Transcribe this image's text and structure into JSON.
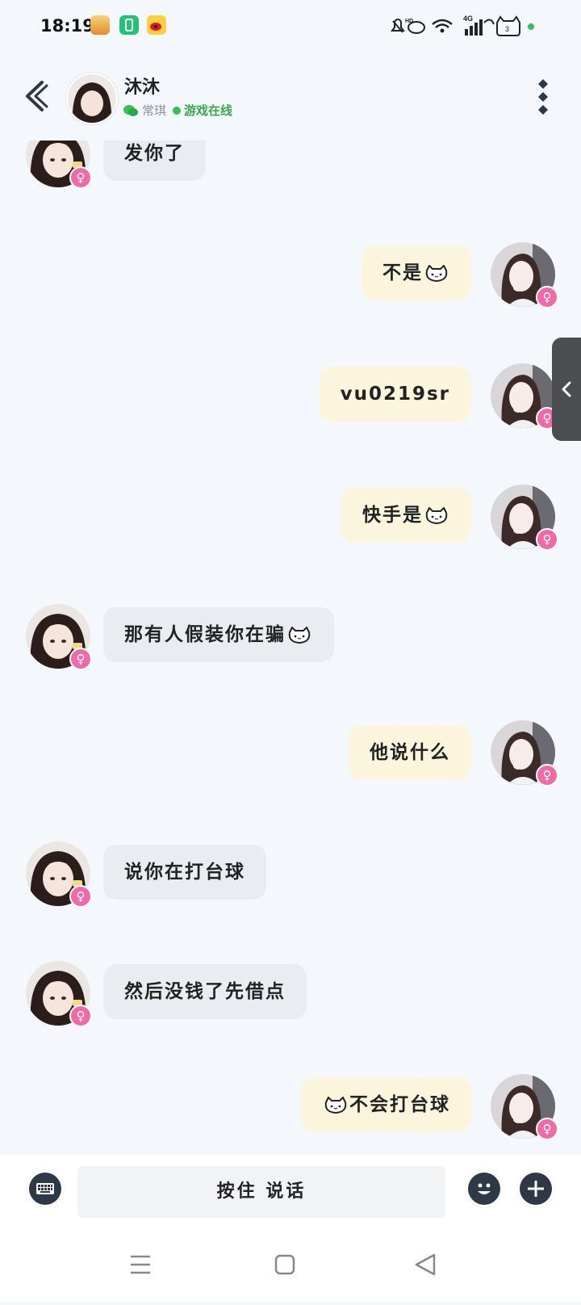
{
  "status_bar": {
    "time": "18:19",
    "hd_label": "HD",
    "network": "4G",
    "notif_count": "3"
  },
  "header": {
    "name": "沐沐",
    "context_label": "常琪",
    "status_label": "游戏在线"
  },
  "messages": [
    {
      "side": "left",
      "text": "发你了"
    },
    {
      "side": "right",
      "text": "不是",
      "emoji": "cat-face"
    },
    {
      "side": "right",
      "text": "vu0219sr"
    },
    {
      "side": "right",
      "text": "快手是",
      "emoji": "cat-face"
    },
    {
      "side": "left",
      "text": "那有人假装你在骗",
      "emoji": "cat-face"
    },
    {
      "side": "right",
      "text": "他说什么"
    },
    {
      "side": "left",
      "text": "说你在打台球"
    },
    {
      "side": "left",
      "text": "然后没钱了先借点"
    },
    {
      "side": "right",
      "text": "不会打台球",
      "emoji_leading": "cat-face"
    }
  ],
  "input_bar": {
    "hold_to_talk_label": "按住 说话"
  },
  "badge_symbol": "♀",
  "colors": {
    "accent_green": "#3bbf55",
    "bubble_in": "#e9edf2",
    "bubble_out": "#faf5dc",
    "badge_pink": "#f06aa8"
  }
}
